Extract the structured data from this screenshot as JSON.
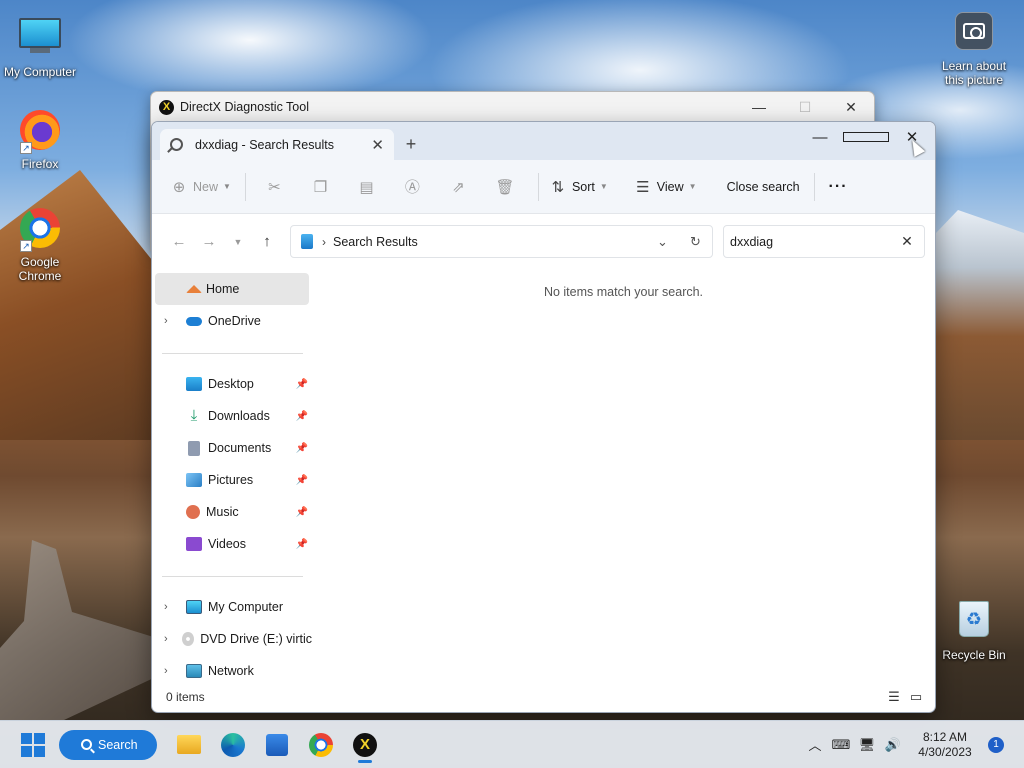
{
  "desktop": {
    "icons": [
      {
        "label": "My Computer"
      },
      {
        "label": "Firefox"
      },
      {
        "label": "Google Chrome"
      },
      {
        "label": "Learn about this picture"
      },
      {
        "label": "Recycle Bin"
      }
    ]
  },
  "dx_window": {
    "title": "DirectX Diagnostic Tool",
    "logo_glyph": "X"
  },
  "explorer": {
    "tab_title": "dxxdiag - Search Results",
    "toolbar": {
      "new_label": "New",
      "sort_label": "Sort",
      "view_label": "View",
      "close_search_label": "Close search",
      "more_label": "···"
    },
    "address": {
      "crumb": "Search Results"
    },
    "search": {
      "value": "dxxdiag"
    },
    "nav": {
      "home": "Home",
      "onedrive": "OneDrive",
      "quick": [
        {
          "label": "Desktop"
        },
        {
          "label": "Downloads"
        },
        {
          "label": "Documents"
        },
        {
          "label": "Pictures"
        },
        {
          "label": "Music"
        },
        {
          "label": "Videos"
        }
      ],
      "my_computer": "My Computer",
      "dvd": "DVD Drive (E:) virtic",
      "network": "Network"
    },
    "empty_message": "No items match your search.",
    "status": "0 items"
  },
  "taskbar": {
    "search_label": "Search",
    "time": "8:12 AM",
    "date": "4/30/2023",
    "notifications": "1"
  }
}
